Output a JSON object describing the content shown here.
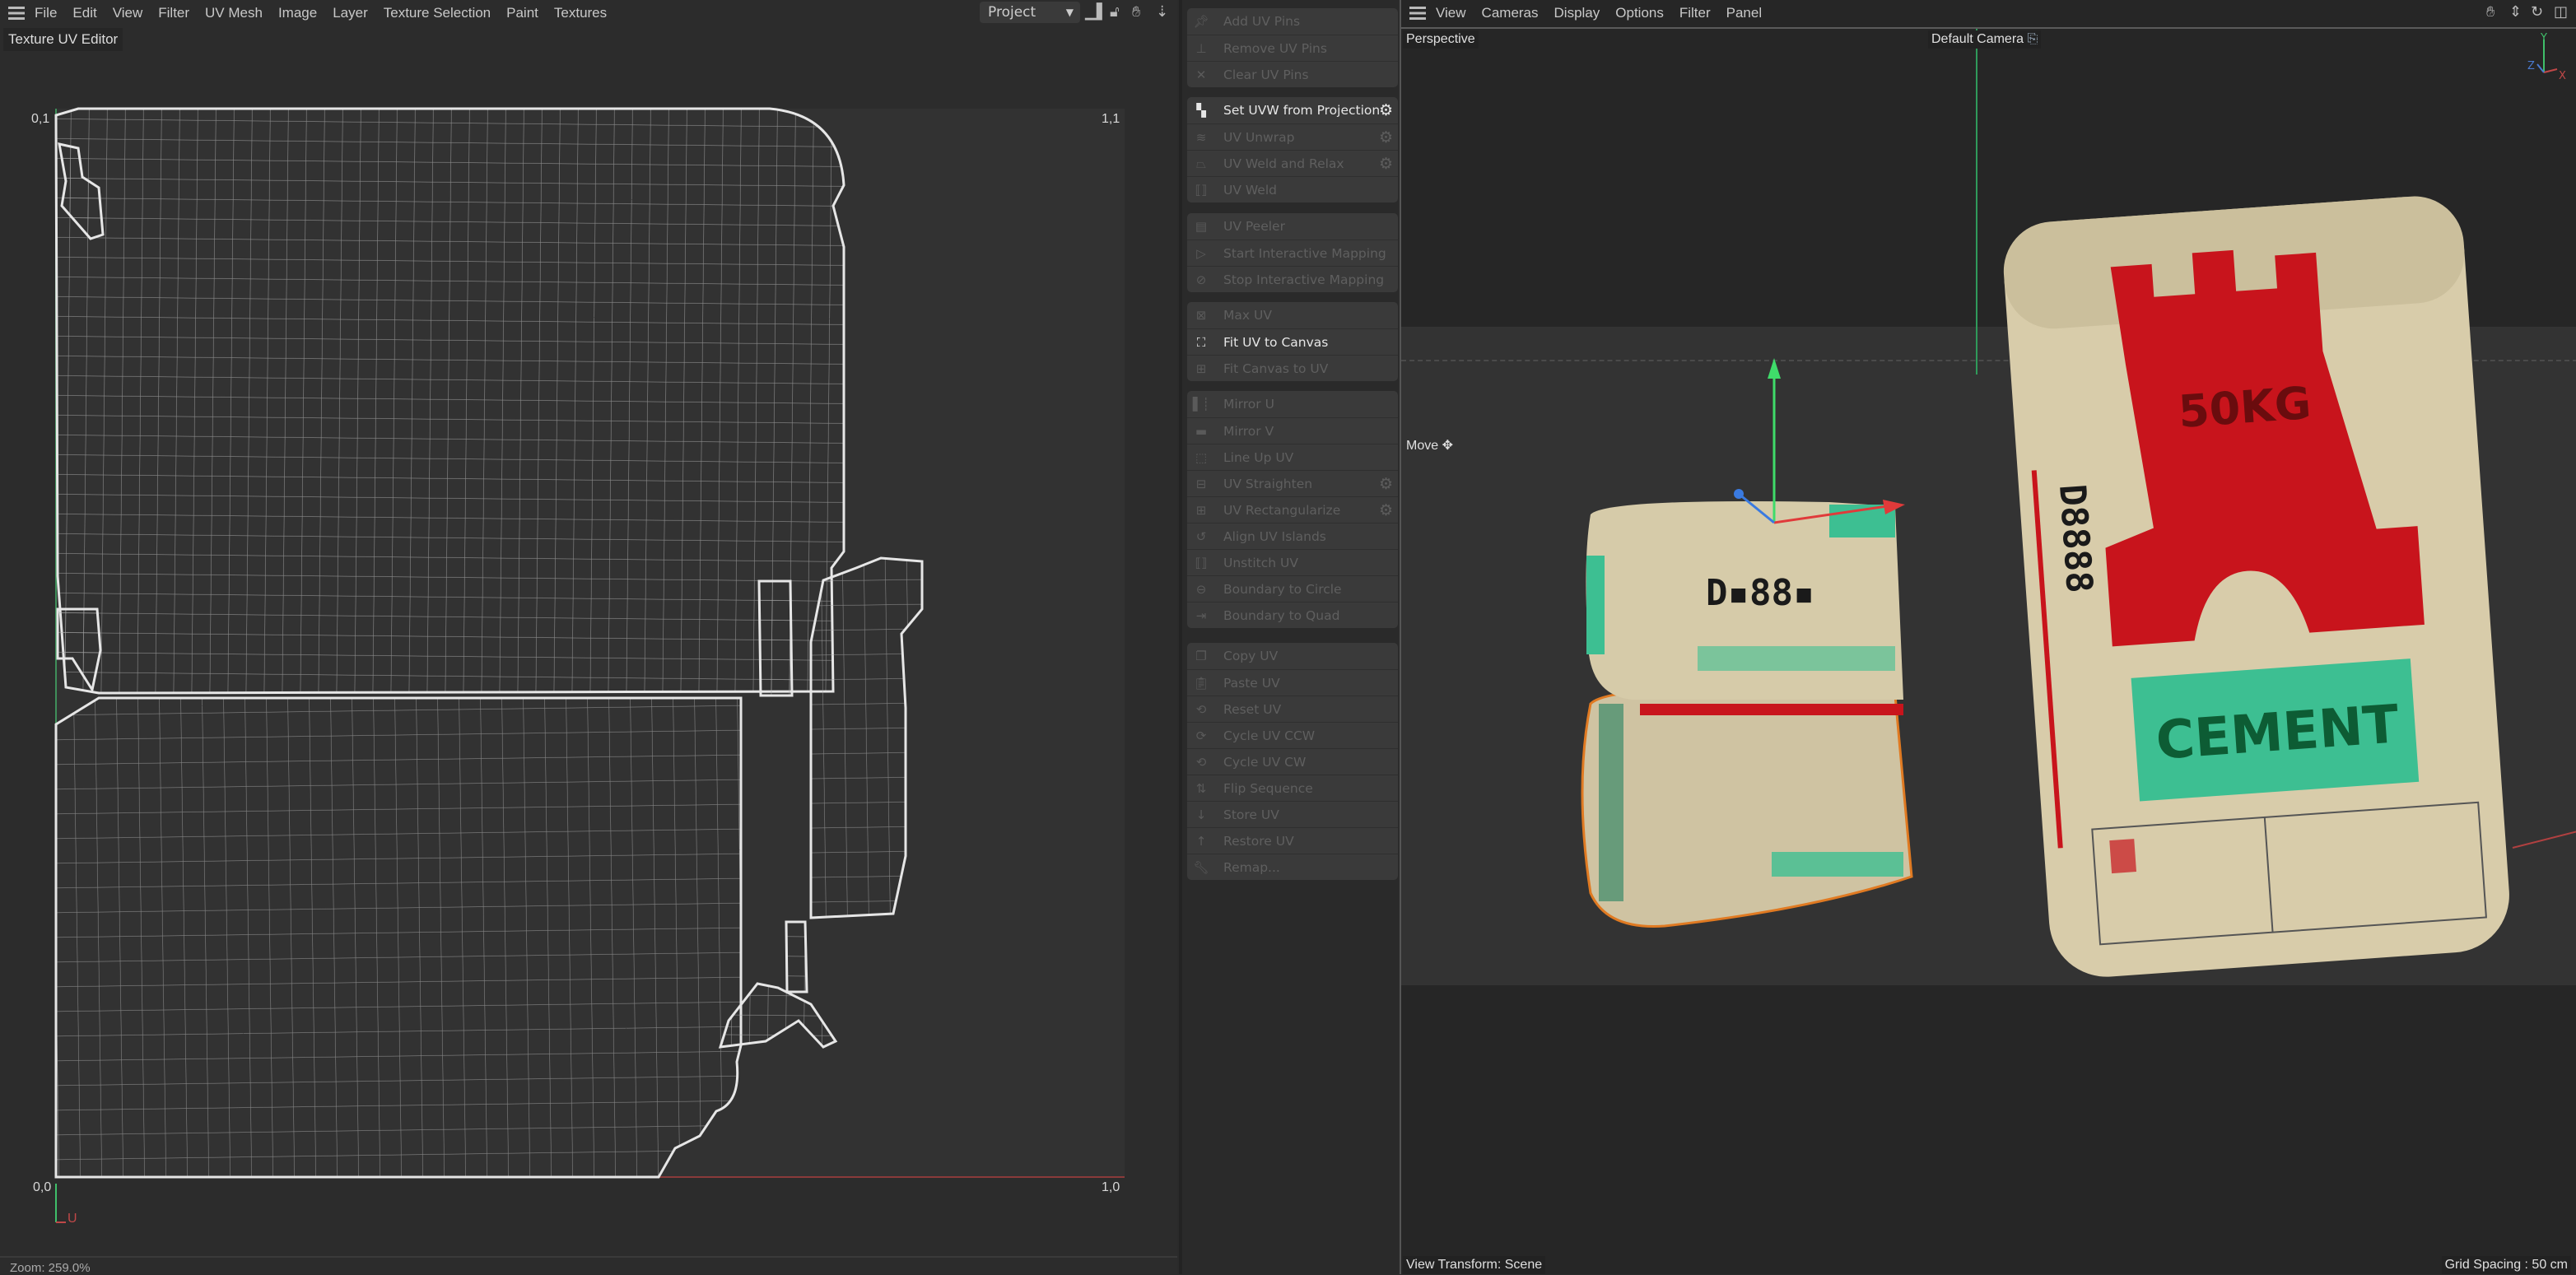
{
  "left_panel": {
    "menu": [
      "File",
      "Edit",
      "View",
      "Filter",
      "UV Mesh",
      "Image",
      "Layer",
      "Texture Selection",
      "Paint",
      "Textures"
    ],
    "project_select": "Project",
    "toolbar_icons": [
      "histogram-icon",
      "lock-icon",
      "hand-pan-icon",
      "move-vertical-icon"
    ],
    "tab_title": "Texture UV Editor",
    "canvas_labels": {
      "top_left": "0,1",
      "top_right": "1,1",
      "bottom_left": "0,0",
      "bottom_right": "1,0",
      "axis_u": "U"
    },
    "zoom_status": "Zoom: 259.0%",
    "colors": {
      "u_axis": "#c04848",
      "v_axis": "#3fbf6a",
      "mesh": "#cfcfcf"
    }
  },
  "uv_commands": {
    "groups": [
      [
        {
          "label": "Add UV Pins",
          "icon": "pin-icon",
          "enabled": false
        },
        {
          "label": "Remove UV Pins",
          "icon": "unpin-icon",
          "enabled": false
        },
        {
          "label": "Clear UV Pins",
          "icon": "x-icon",
          "enabled": false
        }
      ],
      [
        {
          "label": "Set UVW from Projection",
          "icon": "checker-icon",
          "enabled": true,
          "gear": true
        },
        {
          "label": "UV Unwrap",
          "icon": "unwrap-icon",
          "enabled": false,
          "gear": true
        },
        {
          "label": "UV Weld and Relax",
          "icon": "iron-icon",
          "enabled": false,
          "gear": true
        },
        {
          "label": "UV Weld",
          "icon": "weld-icon",
          "enabled": false
        }
      ],
      [
        {
          "label": "UV Peeler",
          "icon": "peeler-icon",
          "enabled": false
        },
        {
          "label": "Start Interactive Mapping",
          "icon": "play-icon",
          "enabled": false
        },
        {
          "label": "Stop Interactive Mapping",
          "icon": "stop-icon",
          "enabled": false
        }
      ],
      [
        {
          "label": "Max UV",
          "icon": "max-icon",
          "enabled": false
        },
        {
          "label": "Fit UV to Canvas",
          "icon": "fit-icon",
          "enabled": true
        },
        {
          "label": "Fit Canvas to UV",
          "icon": "fit-canvas-icon",
          "enabled": false
        }
      ],
      [
        {
          "label": "Mirror U",
          "icon": "mirror-u-icon",
          "enabled": false
        },
        {
          "label": "Mirror V",
          "icon": "mirror-v-icon",
          "enabled": false
        },
        {
          "label": "Line Up UV",
          "icon": "line-up-icon",
          "enabled": false
        },
        {
          "label": "UV Straighten",
          "icon": "straighten-icon",
          "enabled": false,
          "gear": true
        },
        {
          "label": "UV Rectangularize",
          "icon": "grid-icon",
          "enabled": false,
          "gear": true
        },
        {
          "label": "Align UV Islands",
          "icon": "align-icon",
          "enabled": false
        },
        {
          "label": "Unstitch UV",
          "icon": "unstitch-icon",
          "enabled": false
        },
        {
          "label": "Boundary to Circle",
          "icon": "circle-arrow-icon",
          "enabled": false
        },
        {
          "label": "Boundary to Quad",
          "icon": "quad-arrow-icon",
          "enabled": false
        }
      ],
      [
        {
          "label": "Copy UV",
          "icon": "copy-icon",
          "enabled": false
        },
        {
          "label": "Paste UV",
          "icon": "paste-icon",
          "enabled": false
        },
        {
          "label": "Reset UV",
          "icon": "reset-icon",
          "enabled": false
        },
        {
          "label": "Cycle UV CCW",
          "icon": "cycle-ccw-icon",
          "enabled": false
        },
        {
          "label": "Cycle UV CW",
          "icon": "cycle-cw-icon",
          "enabled": false
        },
        {
          "label": "Flip Sequence",
          "icon": "flip-icon",
          "enabled": false
        },
        {
          "label": "Store UV",
          "icon": "store-icon",
          "enabled": false
        },
        {
          "label": "Restore UV",
          "icon": "restore-icon",
          "enabled": false
        },
        {
          "label": "Remap...",
          "icon": "wrench-icon",
          "enabled": false
        }
      ]
    ]
  },
  "viewport": {
    "menu": [
      "View",
      "Cameras",
      "Display",
      "Options",
      "Filter",
      "Panel"
    ],
    "toolbar_icons": [
      "hand-pan-icon",
      "move-vertical-icon",
      "rotate-icon",
      "maximize-icon"
    ],
    "view_name": "Perspective",
    "camera": "Default Camera",
    "tool": "Move",
    "view_transform": "View Transform: Scene",
    "grid_spacing": "Grid Spacing : 50 cm",
    "axes": {
      "x": "X",
      "y": "Y",
      "z": "Z"
    },
    "bag_text": {
      "weight": "50KG",
      "product": "CEMENT"
    },
    "colors": {
      "bag": "#d8ccaa",
      "red": "#c8141c",
      "green": "#3dbf92",
      "selection": "#e07a22"
    }
  }
}
